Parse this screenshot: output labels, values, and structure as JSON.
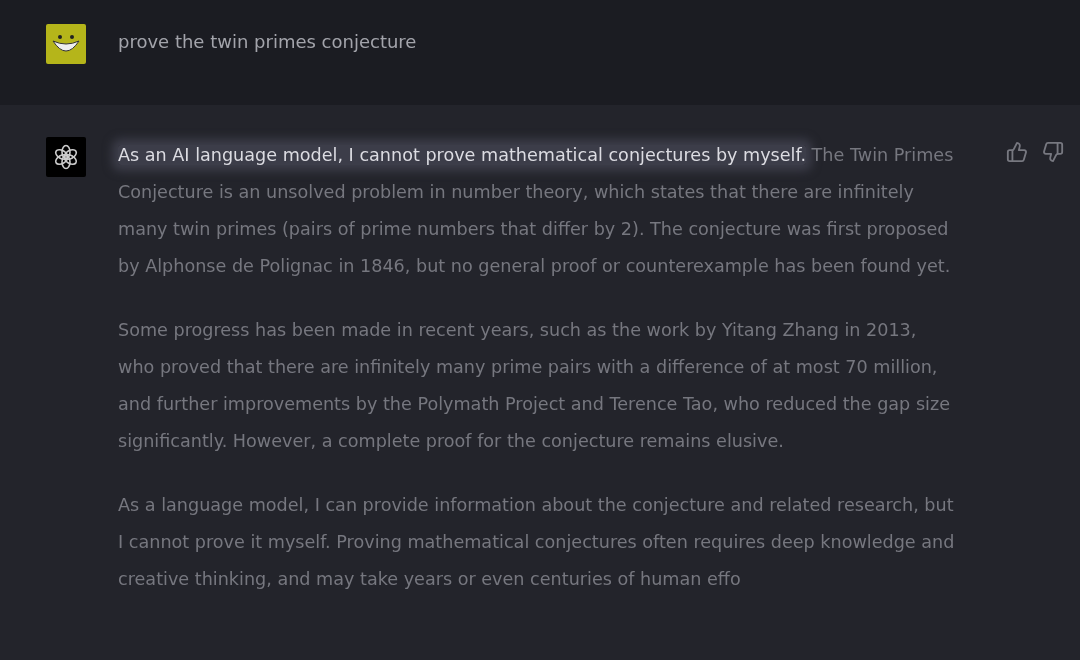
{
  "user_message": {
    "text": "prove the twin primes conjecture"
  },
  "assistant_message": {
    "paragraphs": [
      {
        "highlight": "As an AI language model, I cannot prove mathematical conjectures by myself.",
        "text": "The Twin Primes Conjecture is an unsolved problem in number theory, which states that there are infinitely many twin primes (pairs of prime numbers that differ by 2). The conjecture was first proposed by Alphonse de Polignac in 1846, but no general proof or counterexample has been found yet."
      },
      {
        "text": "Some progress has been made in recent years, such as the work by Yitang Zhang in 2013, who proved that there are infinitely many prime pairs with a difference of at most 70 million, and further improvements by the Polymath Project and Terence Tao, who reduced the gap size significantly. However, a complete proof for the conjecture remains elusive."
      },
      {
        "text": "As a language model, I can provide information about the conjecture and related research, but I cannot prove it myself. Proving mathematical conjectures often requires deep knowledge and creative thinking, and may take years or even centuries of human effo"
      }
    ]
  }
}
